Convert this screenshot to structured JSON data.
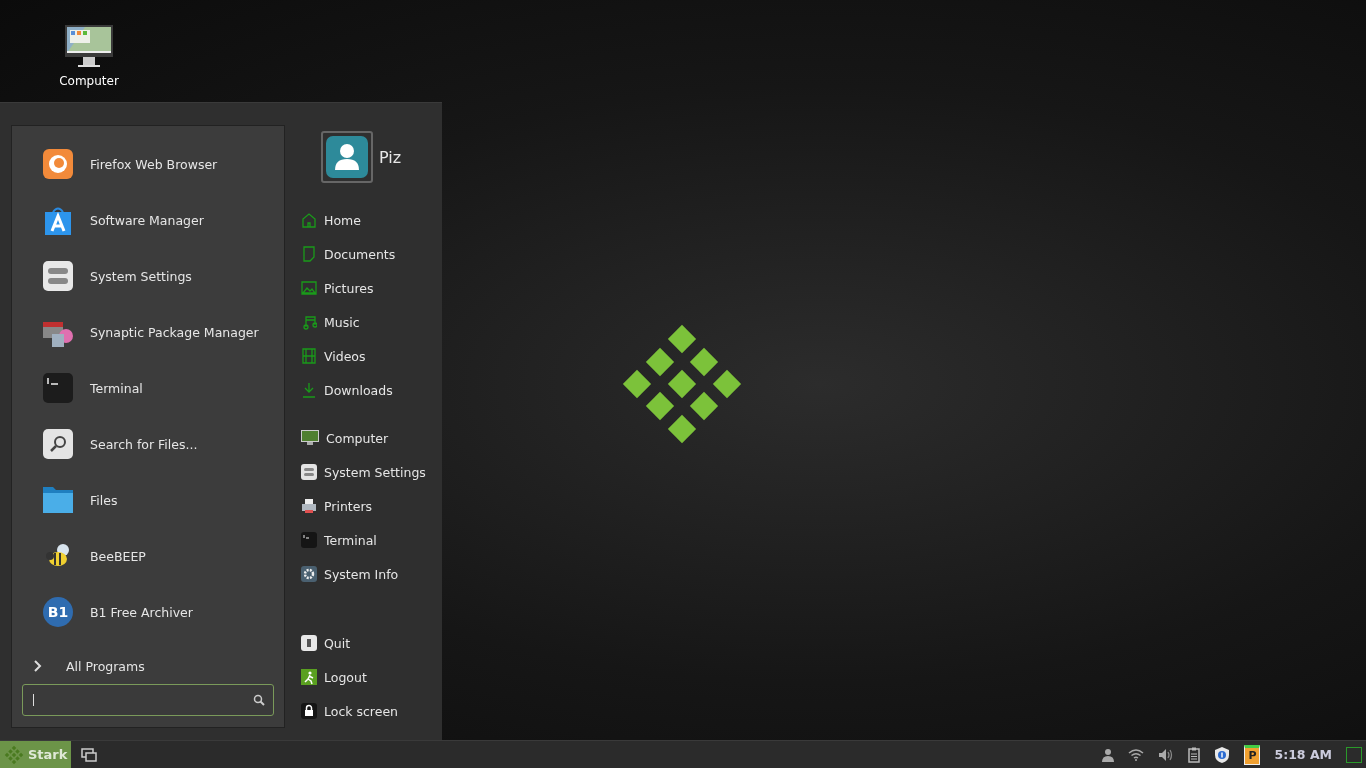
{
  "desktop": {
    "icons": [
      {
        "label": "Computer",
        "kind": "computer"
      }
    ]
  },
  "menu": {
    "favorites": [
      {
        "label": "Firefox Web Browser",
        "kind": "firefox"
      },
      {
        "label": "Software Manager",
        "kind": "store"
      },
      {
        "label": "System Settings",
        "kind": "settings"
      },
      {
        "label": "Synaptic Package Manager",
        "kind": "package"
      },
      {
        "label": "Terminal",
        "kind": "terminal"
      },
      {
        "label": "Search for Files...",
        "kind": "search"
      },
      {
        "label": "Files",
        "kind": "folder"
      },
      {
        "label": "BeeBEEP",
        "kind": "bee"
      },
      {
        "label": "B1 Free Archiver",
        "kind": "archiver",
        "badge": "B1"
      }
    ],
    "all_programs": "All Programs",
    "user": {
      "name": "Piz"
    },
    "places": [
      {
        "label": "Home",
        "kind": "home"
      },
      {
        "label": "Documents",
        "kind": "document"
      },
      {
        "label": "Pictures",
        "kind": "picture"
      },
      {
        "label": "Music",
        "kind": "music"
      },
      {
        "label": "Videos",
        "kind": "video"
      },
      {
        "label": "Downloads",
        "kind": "download"
      }
    ],
    "system": [
      {
        "label": "Computer",
        "kind": "computer"
      },
      {
        "label": "System Settings",
        "kind": "settings"
      },
      {
        "label": "Printers",
        "kind": "printer"
      },
      {
        "label": "Terminal",
        "kind": "terminal"
      },
      {
        "label": "System Info",
        "kind": "gear"
      }
    ],
    "session": [
      {
        "label": "Quit",
        "kind": "quit"
      },
      {
        "label": "Logout",
        "kind": "logout"
      },
      {
        "label": "Lock screen",
        "kind": "lock"
      }
    ]
  },
  "taskbar": {
    "start_label": "Stark",
    "tray": [
      {
        "kind": "user"
      },
      {
        "kind": "wifi"
      },
      {
        "kind": "volume"
      },
      {
        "kind": "clipboard"
      },
      {
        "kind": "shield"
      },
      {
        "kind": "badge",
        "text": "P"
      }
    ],
    "clock": "5:18 AM"
  }
}
